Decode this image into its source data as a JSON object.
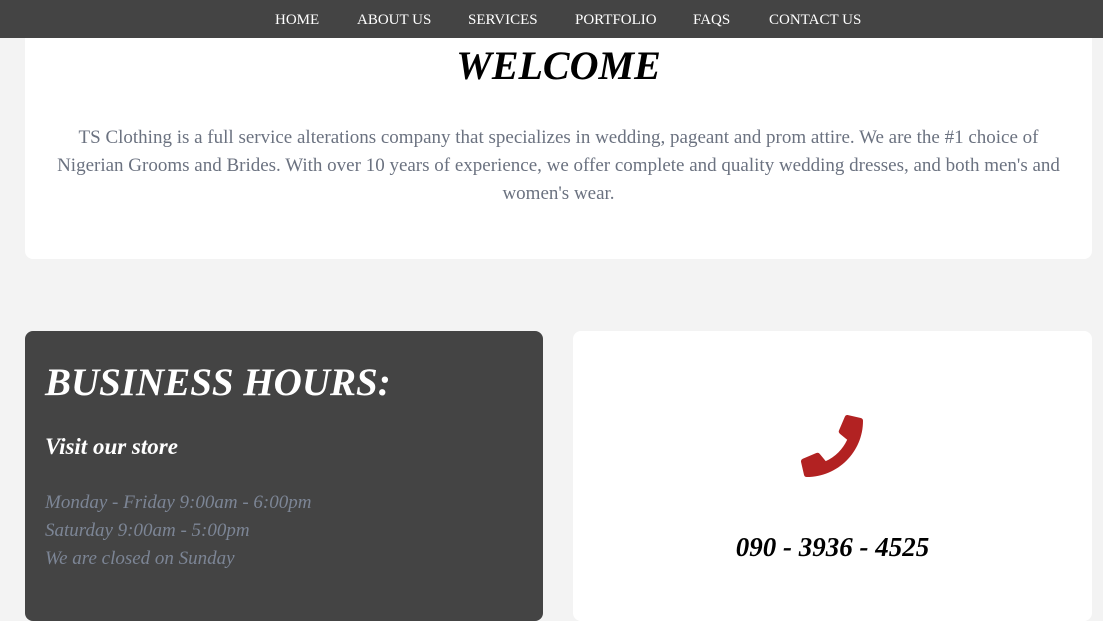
{
  "nav": {
    "items": [
      "HOME",
      "ABOUT US",
      "SERVICES",
      "PORTFOLIO",
      "FAQS",
      "CONTACT US"
    ]
  },
  "welcome": {
    "title": "WELCOME",
    "text": "TS Clothing is a full service alterations company that specializes in wedding, pageant and prom attire. We are the #1 choice of Nigerian Grooms and Brides. With over 10 years of experience, we offer complete and quality wedding dresses, and both men's and women's wear."
  },
  "hours": {
    "title": "BUSINESS HOURS:",
    "subtitle": "Visit our store",
    "lines": [
      "Monday - Friday 9:00am - 6:00pm",
      "Saturday 9:00am - 5:00pm",
      "We are closed on Sunday"
    ]
  },
  "contact": {
    "icon": "phone-icon",
    "phone": "090 - 3936 - 4525"
  },
  "colors": {
    "navbar": "#444444",
    "page_background": "#f3f3f3",
    "accent_phone_icon": "#b22222",
    "muted_text": "#6b7280"
  }
}
